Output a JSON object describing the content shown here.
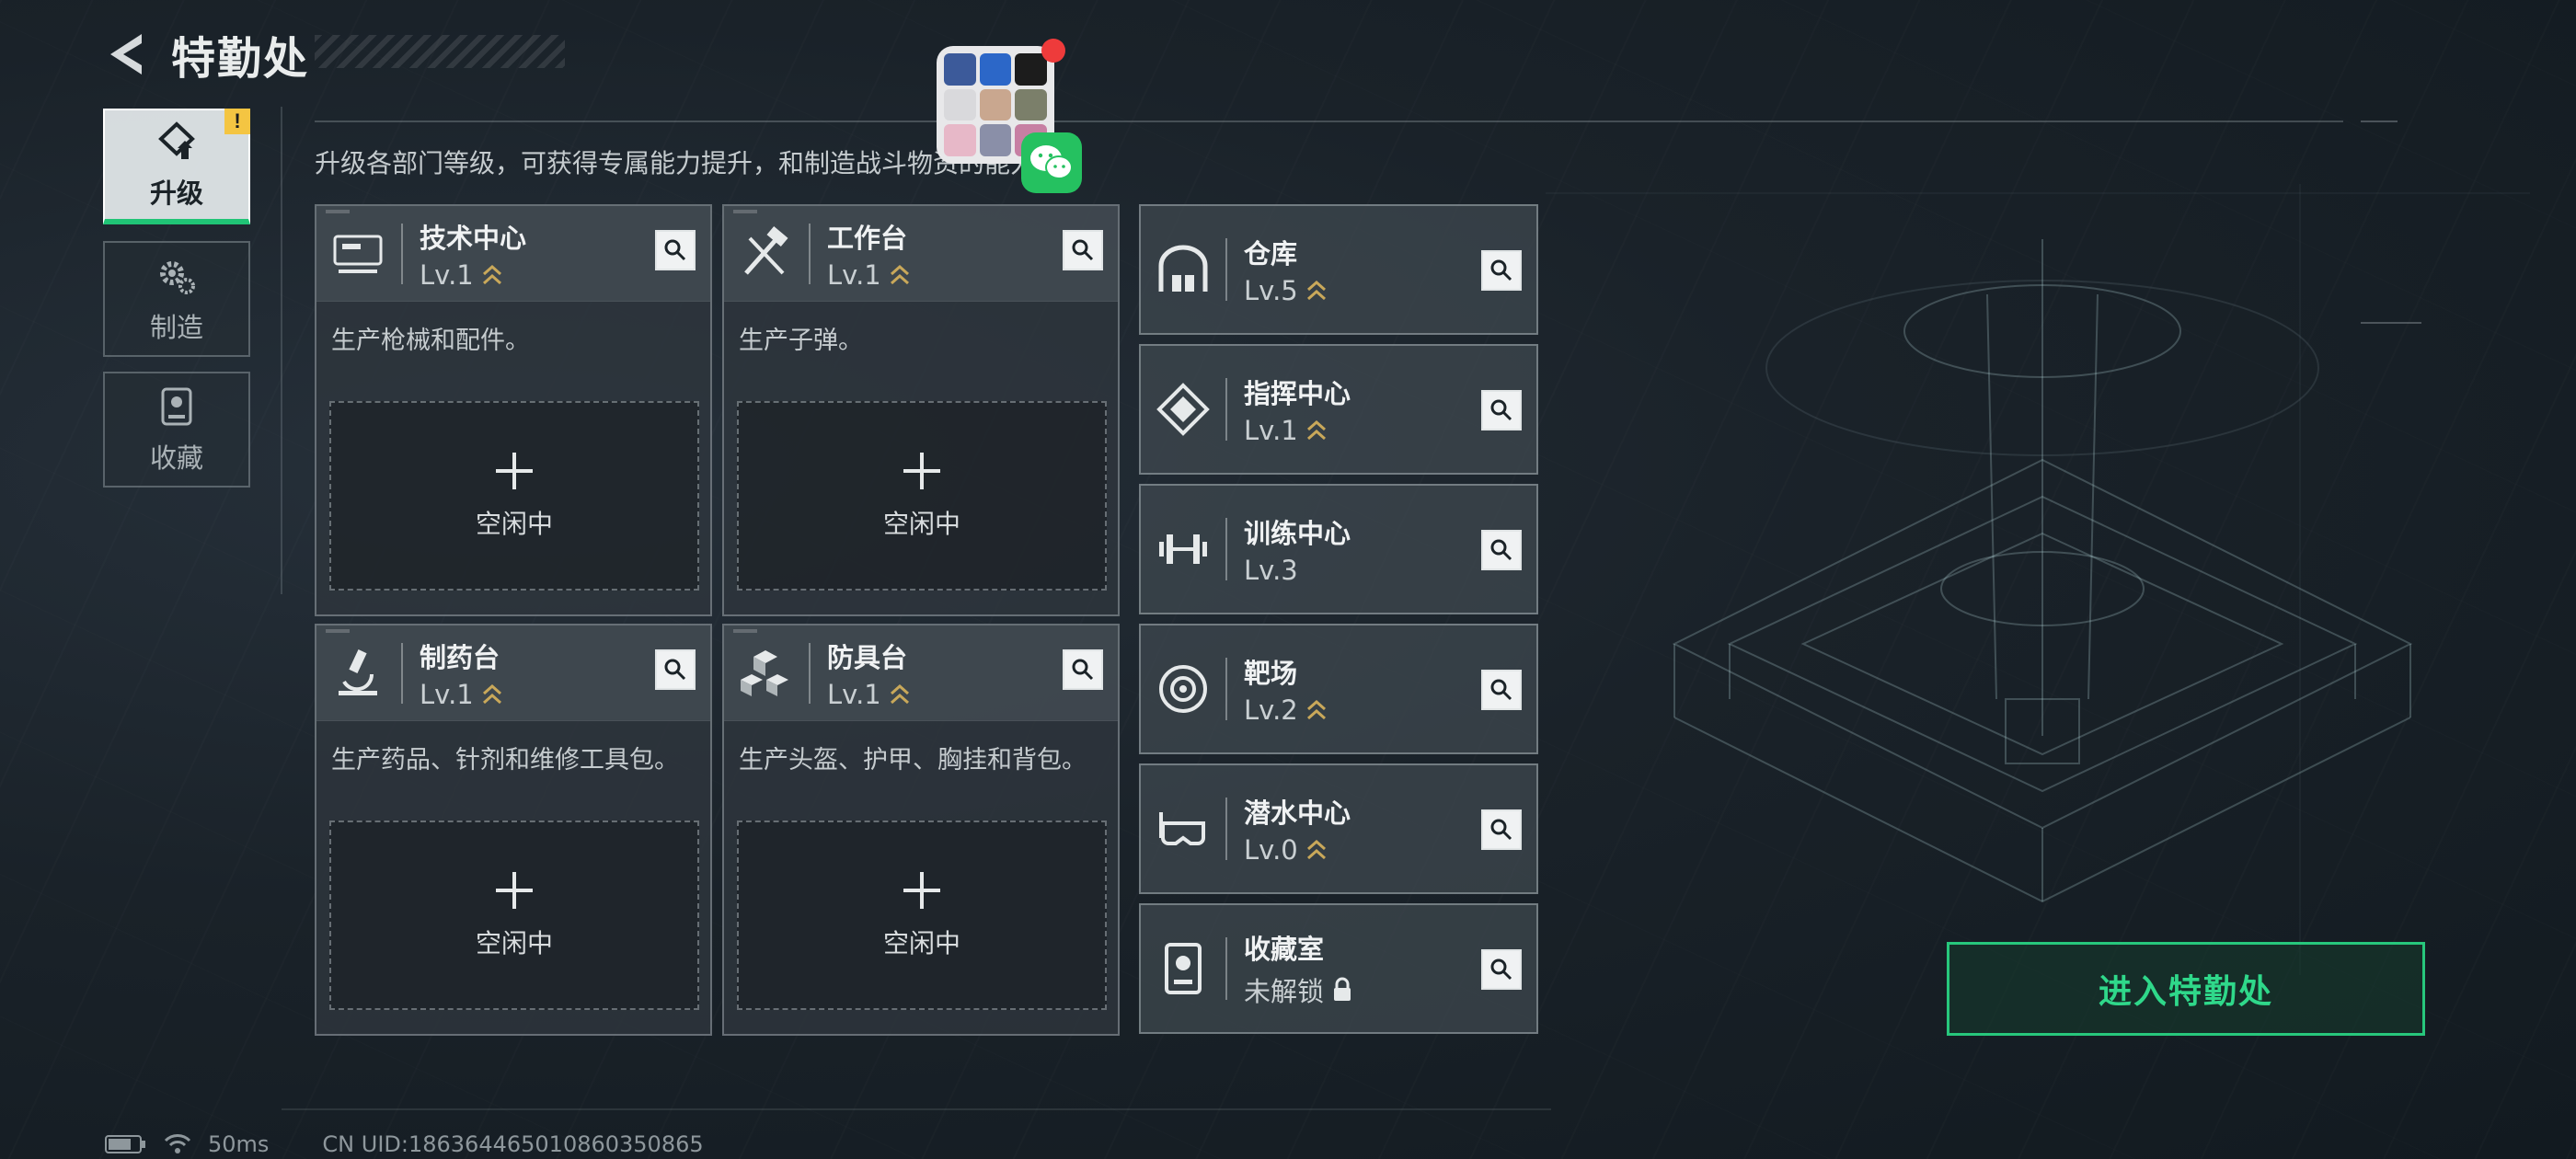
{
  "header": {
    "title": "特勤处",
    "back_icon": "back-arrow-icon"
  },
  "subtitle": "升级各部门等级，可获得专属能力提升，和制造战斗物资的能力",
  "nav": [
    {
      "label": "升级",
      "icon": "upgrade-icon",
      "active": true,
      "badge": "!"
    },
    {
      "label": "制造",
      "icon": "gear-icon",
      "active": false
    },
    {
      "label": "收藏",
      "icon": "trophy-case-icon",
      "active": false
    }
  ],
  "cards": [
    {
      "name": "技术中心",
      "level": "Lv.1",
      "desc": "生产枪械和配件。",
      "slot": "空闲中",
      "icon": "computer-icon"
    },
    {
      "name": "工作台",
      "level": "Lv.1",
      "desc": "生产子弹。",
      "slot": "空闲中",
      "icon": "tools-icon"
    },
    {
      "name": "制药台",
      "level": "Lv.1",
      "desc": "生产药品、针剂和维修工具包。",
      "slot": "空闲中",
      "icon": "microscope-icon"
    },
    {
      "name": "防具台",
      "level": "Lv.1",
      "desc": "生产头盔、护甲、胸挂和背包。",
      "slot": "空闲中",
      "icon": "cubes-icon"
    }
  ],
  "small_cards": [
    {
      "name": "仓库",
      "level": "Lv.5",
      "icon": "warehouse-icon",
      "upgrade": true
    },
    {
      "name": "指挥中心",
      "level": "Lv.1",
      "icon": "command-icon",
      "upgrade": true
    },
    {
      "name": "训练中心",
      "level": "Lv.3",
      "icon": "dumbbell-icon",
      "upgrade": false
    },
    {
      "name": "靶场",
      "level": "Lv.2",
      "icon": "target-icon",
      "upgrade": true
    },
    {
      "name": "潜水中心",
      "level": "Lv.0",
      "icon": "diving-mask-icon",
      "upgrade": true
    },
    {
      "name": "收藏室",
      "level": "未解锁",
      "icon": "collection-icon",
      "locked": true
    }
  ],
  "enter_button": "进入特勤处",
  "footer": {
    "ping": "50ms",
    "uid": "CN UID:18636446501086035086​5"
  },
  "colors": {
    "accent": "#2fd88a",
    "badge": "#f4c542",
    "chevron": "#c9a85a"
  }
}
